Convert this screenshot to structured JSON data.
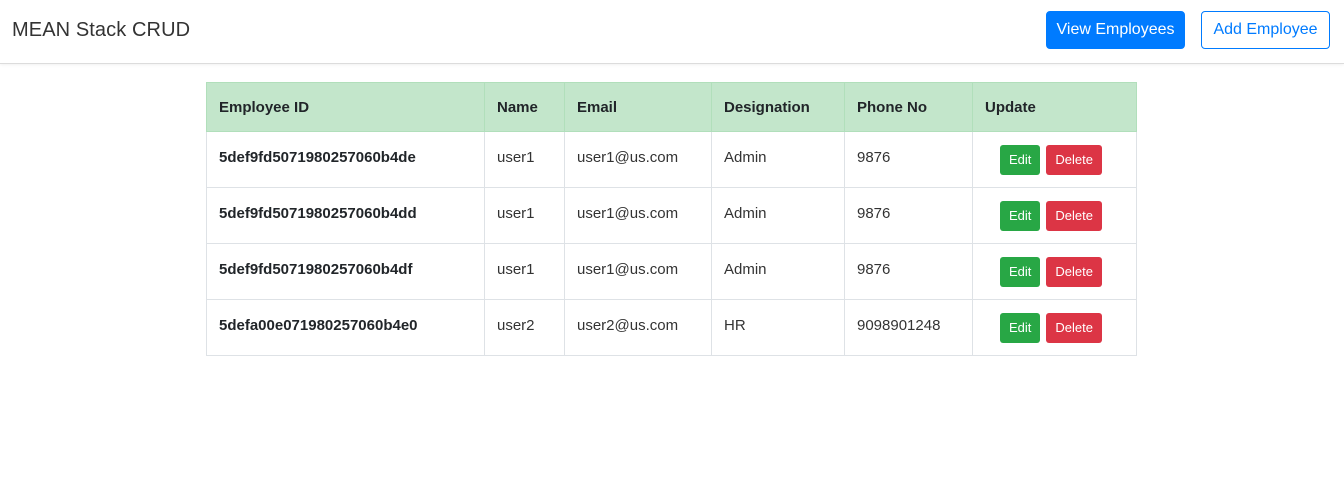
{
  "header": {
    "brand": "MEAN Stack CRUD",
    "view_employees_label": "View Employees",
    "add_employee_label": "Add Employee"
  },
  "colors": {
    "primary": "#007bff",
    "table_header_bg": "#c3e6cb",
    "edit": "#28a745",
    "delete": "#dc3545"
  },
  "table": {
    "columns": [
      "Employee ID",
      "Name",
      "Email",
      "Designation",
      "Phone No",
      "Update"
    ],
    "rows": [
      {
        "id": "5def9fd5071980257060b4de",
        "name": "user1",
        "email": "user1@us.com",
        "designation": "Admin",
        "phone": "9876",
        "edit_label": "Edit",
        "delete_label": "Delete"
      },
      {
        "id": "5def9fd5071980257060b4dd",
        "name": "user1",
        "email": "user1@us.com",
        "designation": "Admin",
        "phone": "9876",
        "edit_label": "Edit",
        "delete_label": "Delete"
      },
      {
        "id": "5def9fd5071980257060b4df",
        "name": "user1",
        "email": "user1@us.com",
        "designation": "Admin",
        "phone": "9876",
        "edit_label": "Edit",
        "delete_label": "Delete"
      },
      {
        "id": "5defa00e071980257060b4e0",
        "name": "user2",
        "email": "user2@us.com",
        "designation": "HR",
        "phone": "9098901248",
        "edit_label": "Edit",
        "delete_label": "Delete"
      }
    ]
  }
}
